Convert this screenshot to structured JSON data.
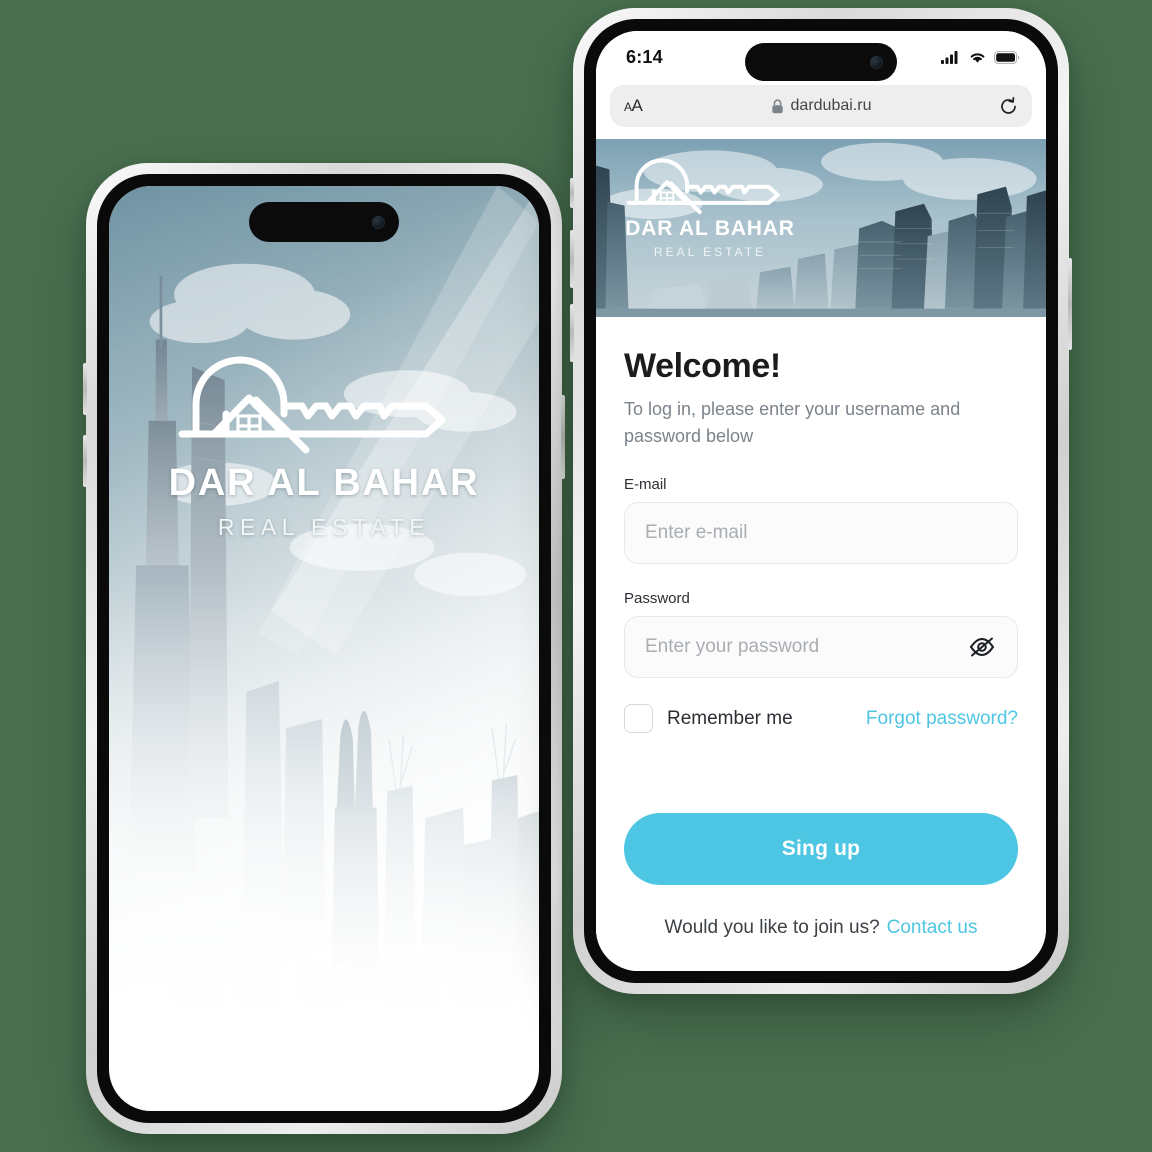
{
  "theme": {
    "page_background": "#4a7050",
    "accent_cyan": "#4cc6e2",
    "link_cyan": "#4ec6e3",
    "text_dark": "#1c1c1e",
    "text_muted": "#7c838b"
  },
  "splash_phone": {
    "name": "dar-al-bahar-splash",
    "brand_name": "DAR AL BAHAR",
    "brand_tagline": "REAL ESTATE",
    "background_description": "Dubai skyline fading to white"
  },
  "browser_phone": {
    "status_bar": {
      "time": "6:14",
      "icons": [
        "cellular-signal-icon",
        "wifi-icon",
        "battery-icon"
      ]
    },
    "safari_toolbar": {
      "text_size_button": "AA",
      "lock_icon": "lock-icon",
      "url": "dardubai.ru",
      "reload_icon": "reload-icon"
    },
    "hero": {
      "brand_name": "DAR AL BAHAR",
      "brand_tagline": "REAL ESTATE"
    },
    "login_form": {
      "title": "Welcome!",
      "subtitle": "To log in, please enter your username and password below",
      "email_label": "E-mail",
      "email_placeholder": "Enter e-mail",
      "email_value": "",
      "password_label": "Password",
      "password_placeholder": "Enter your password",
      "password_value": "",
      "password_toggle_icon": "eye-off-icon",
      "remember_label": "Remember me",
      "remember_checked": false,
      "forgot_link": "Forgot password?",
      "submit_label": "Sing up",
      "join_text": "Would you like to join us?",
      "contact_link": "Contact us"
    }
  }
}
